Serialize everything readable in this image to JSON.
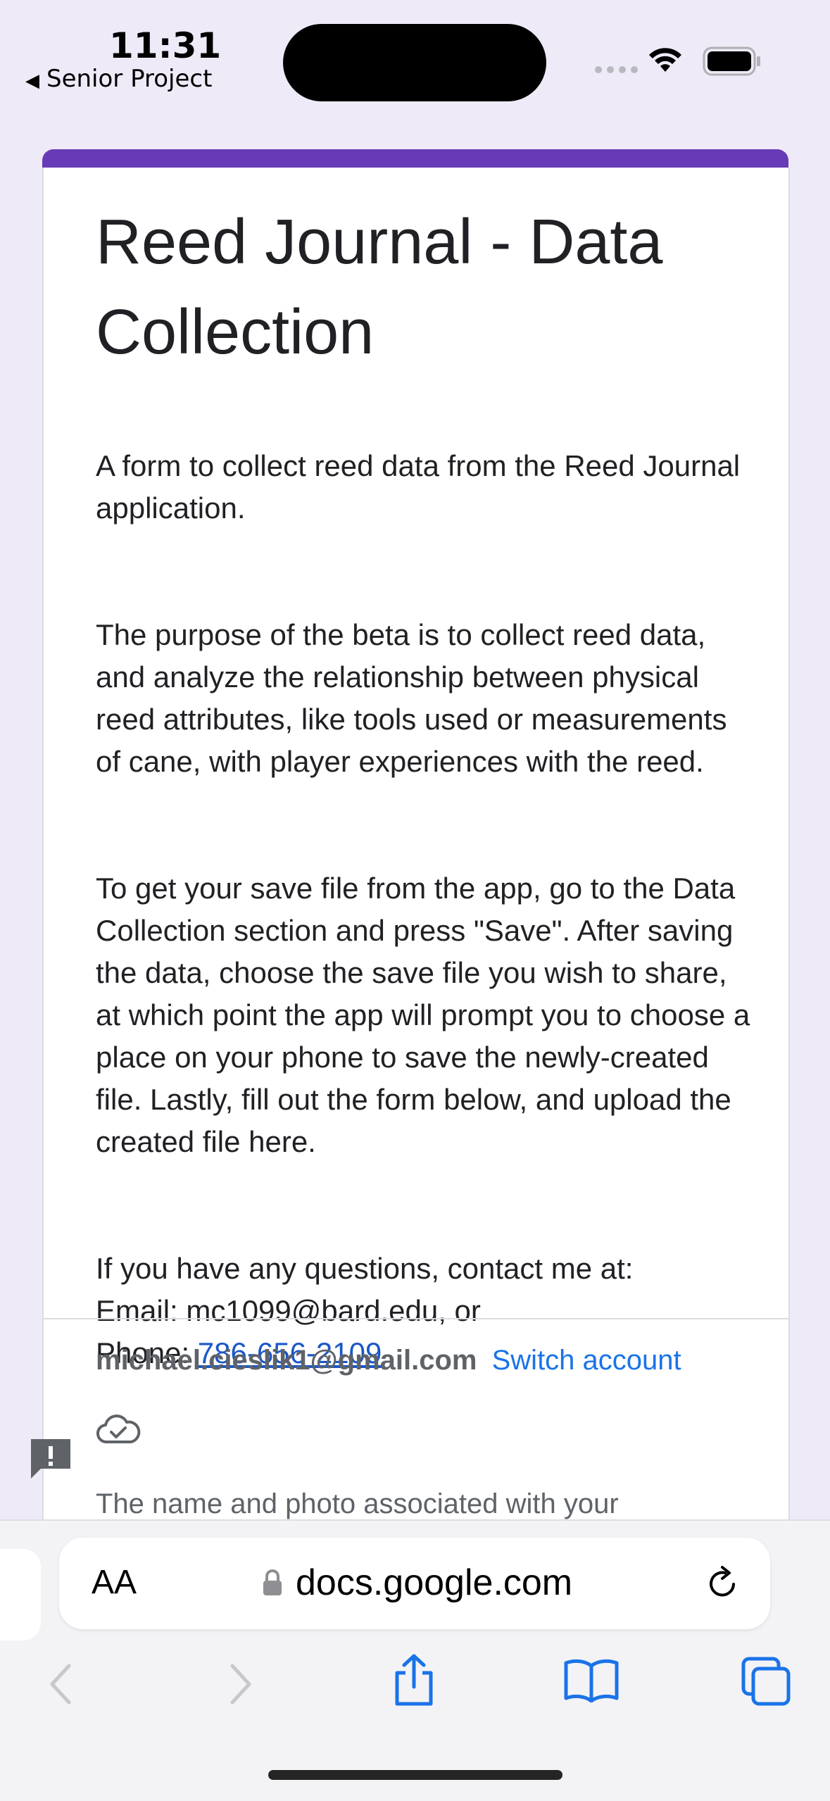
{
  "status_bar": {
    "time": "11:31",
    "back_app": "Senior Project"
  },
  "form": {
    "accent_color": "#673ab7",
    "title": "Reed Journal - Data Collection",
    "paragraphs": [
      "A form to collect reed data from the Reed Journal application.",
      "The purpose of the beta is to collect reed data, and analyze the relationship between physical reed attributes, like tools used or measurements of cane, with player experiences with the reed.",
      "To get your save file from the app, go to the Data Collection section and press \"Save\". After saving the data, choose the save file you wish to share, at which point the app will prompt you to choose a place on your phone to save the newly-created file. Lastly, fill out the form below, and upload the created file here."
    ],
    "contact_intro": "If you have any questions, contact me at:",
    "contact_email": "Email: mc1099@bard.edu, or",
    "contact_phone_label": "Phone: ",
    "contact_phone": "786-656-2109",
    "account_email": "michael.cieslik1@gmail.com",
    "switch_account": "Switch account",
    "notice_partial": "The name and photo associated with your"
  },
  "browser": {
    "text_size_button": "AA",
    "url": "docs.google.com"
  }
}
